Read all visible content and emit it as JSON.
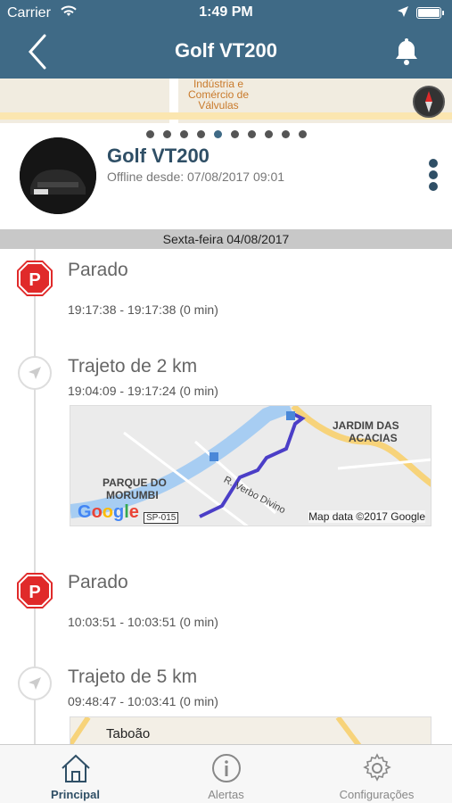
{
  "status_bar": {
    "carrier": "Carrier",
    "time": "1:49 PM"
  },
  "nav": {
    "title": "Golf VT200",
    "back_icon": "chevron-left-icon",
    "bell_icon": "bell-icon"
  },
  "map_header": {
    "label": "Indústria e Comércio de Válvulas"
  },
  "pager": {
    "count": 10,
    "active_index": 4
  },
  "vehicle": {
    "name": "Golf VT200",
    "status": "Offline desde: 07/08/2017 09:01"
  },
  "day": {
    "label": "Sexta-feira 04/08/2017"
  },
  "events": [
    {
      "type": "stop",
      "title": "Parado",
      "time": "19:17:38   - 19:17:38   (0 min)"
    },
    {
      "type": "trip",
      "title": "Trajeto de 2 km",
      "time": "19:04:09  - 19:17:24  (0 min)",
      "map": {
        "labels": [
          "JARDIM DAS",
          "ACACIAS",
          "PARQUE DO",
          "MORUMBI",
          "R. Verbo Divino"
        ],
        "shield": "SP-015",
        "credit": "Map data ©2017 Google"
      }
    },
    {
      "type": "stop",
      "title": "Parado",
      "time": "10:03:51   - 10:03:51   (0 min)"
    },
    {
      "type": "trip",
      "title": "Trajeto de 5 km",
      "time": "09:48:47  - 10:03:41  (0 min)",
      "map": {
        "labels": [
          "Taboão"
        ]
      }
    }
  ],
  "tabs": [
    {
      "label": "Principal",
      "icon": "home-icon",
      "active": true
    },
    {
      "label": "Alertas",
      "icon": "info-icon",
      "active": false
    },
    {
      "label": "Configurações",
      "icon": "gear-icon",
      "active": false
    }
  ],
  "colors": {
    "primary": "#3f6a86",
    "stop_red": "#e02a2a",
    "route": "#4b3ec7"
  }
}
